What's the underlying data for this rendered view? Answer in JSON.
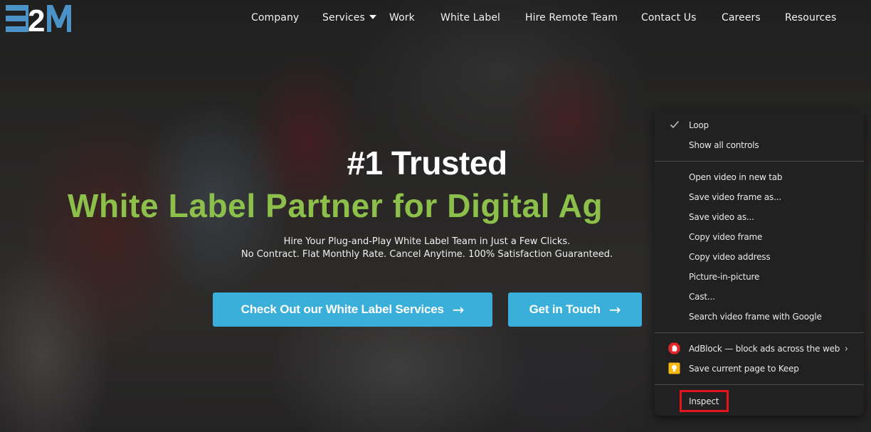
{
  "brand": {
    "logo_text": "E2M",
    "logo_color": "#4b92c6"
  },
  "nav": {
    "items": [
      {
        "label": "Company"
      },
      {
        "label": "Services",
        "has_dropdown": true,
        "icon": "caret-down-icon"
      },
      {
        "label": "Work"
      },
      {
        "label": "White Label"
      },
      {
        "label": "Hire Remote Team"
      },
      {
        "label": "Contact Us"
      },
      {
        "label": "Careers"
      },
      {
        "label": "Resources"
      }
    ]
  },
  "hero": {
    "title_line1": "#1 Trusted",
    "title_line2": "White Label Partner for Digital Ag",
    "subtitle_line1": "Hire Your Plug-and-Play White Label Team in Just a Few Clicks.",
    "subtitle_line2": "No Contract. Flat Monthly Rate. Cancel Anytime. 100% Satisfaction Guaranteed.",
    "accent_green": "#8dc04b",
    "cta_primary": {
      "label": "Check Out our White Label Services",
      "arrow": "→"
    },
    "cta_secondary": {
      "label": "Get in Touch",
      "arrow": "→"
    },
    "cta_color": "#3aafd9"
  },
  "context_menu": {
    "items": [
      {
        "label": "Loop",
        "checked": true,
        "icon": "checkmark-icon"
      },
      {
        "label": "Show all controls"
      },
      {
        "label": "Open video in new tab"
      },
      {
        "label": "Save video frame as..."
      },
      {
        "label": "Save video as..."
      },
      {
        "label": "Copy video frame"
      },
      {
        "label": "Copy video address"
      },
      {
        "label": "Picture-in-picture"
      },
      {
        "label": "Cast..."
      },
      {
        "label": "Search video frame with Google"
      },
      {
        "label": "AdBlock — block ads across the web",
        "icon": "adblock-icon",
        "has_submenu": true,
        "submenu_arrow": "›"
      },
      {
        "label": "Save current page to Keep",
        "icon": "google-keep-icon"
      },
      {
        "label": "Inspect",
        "highlighted": true
      }
    ],
    "highlight_color": "#e3141e"
  }
}
